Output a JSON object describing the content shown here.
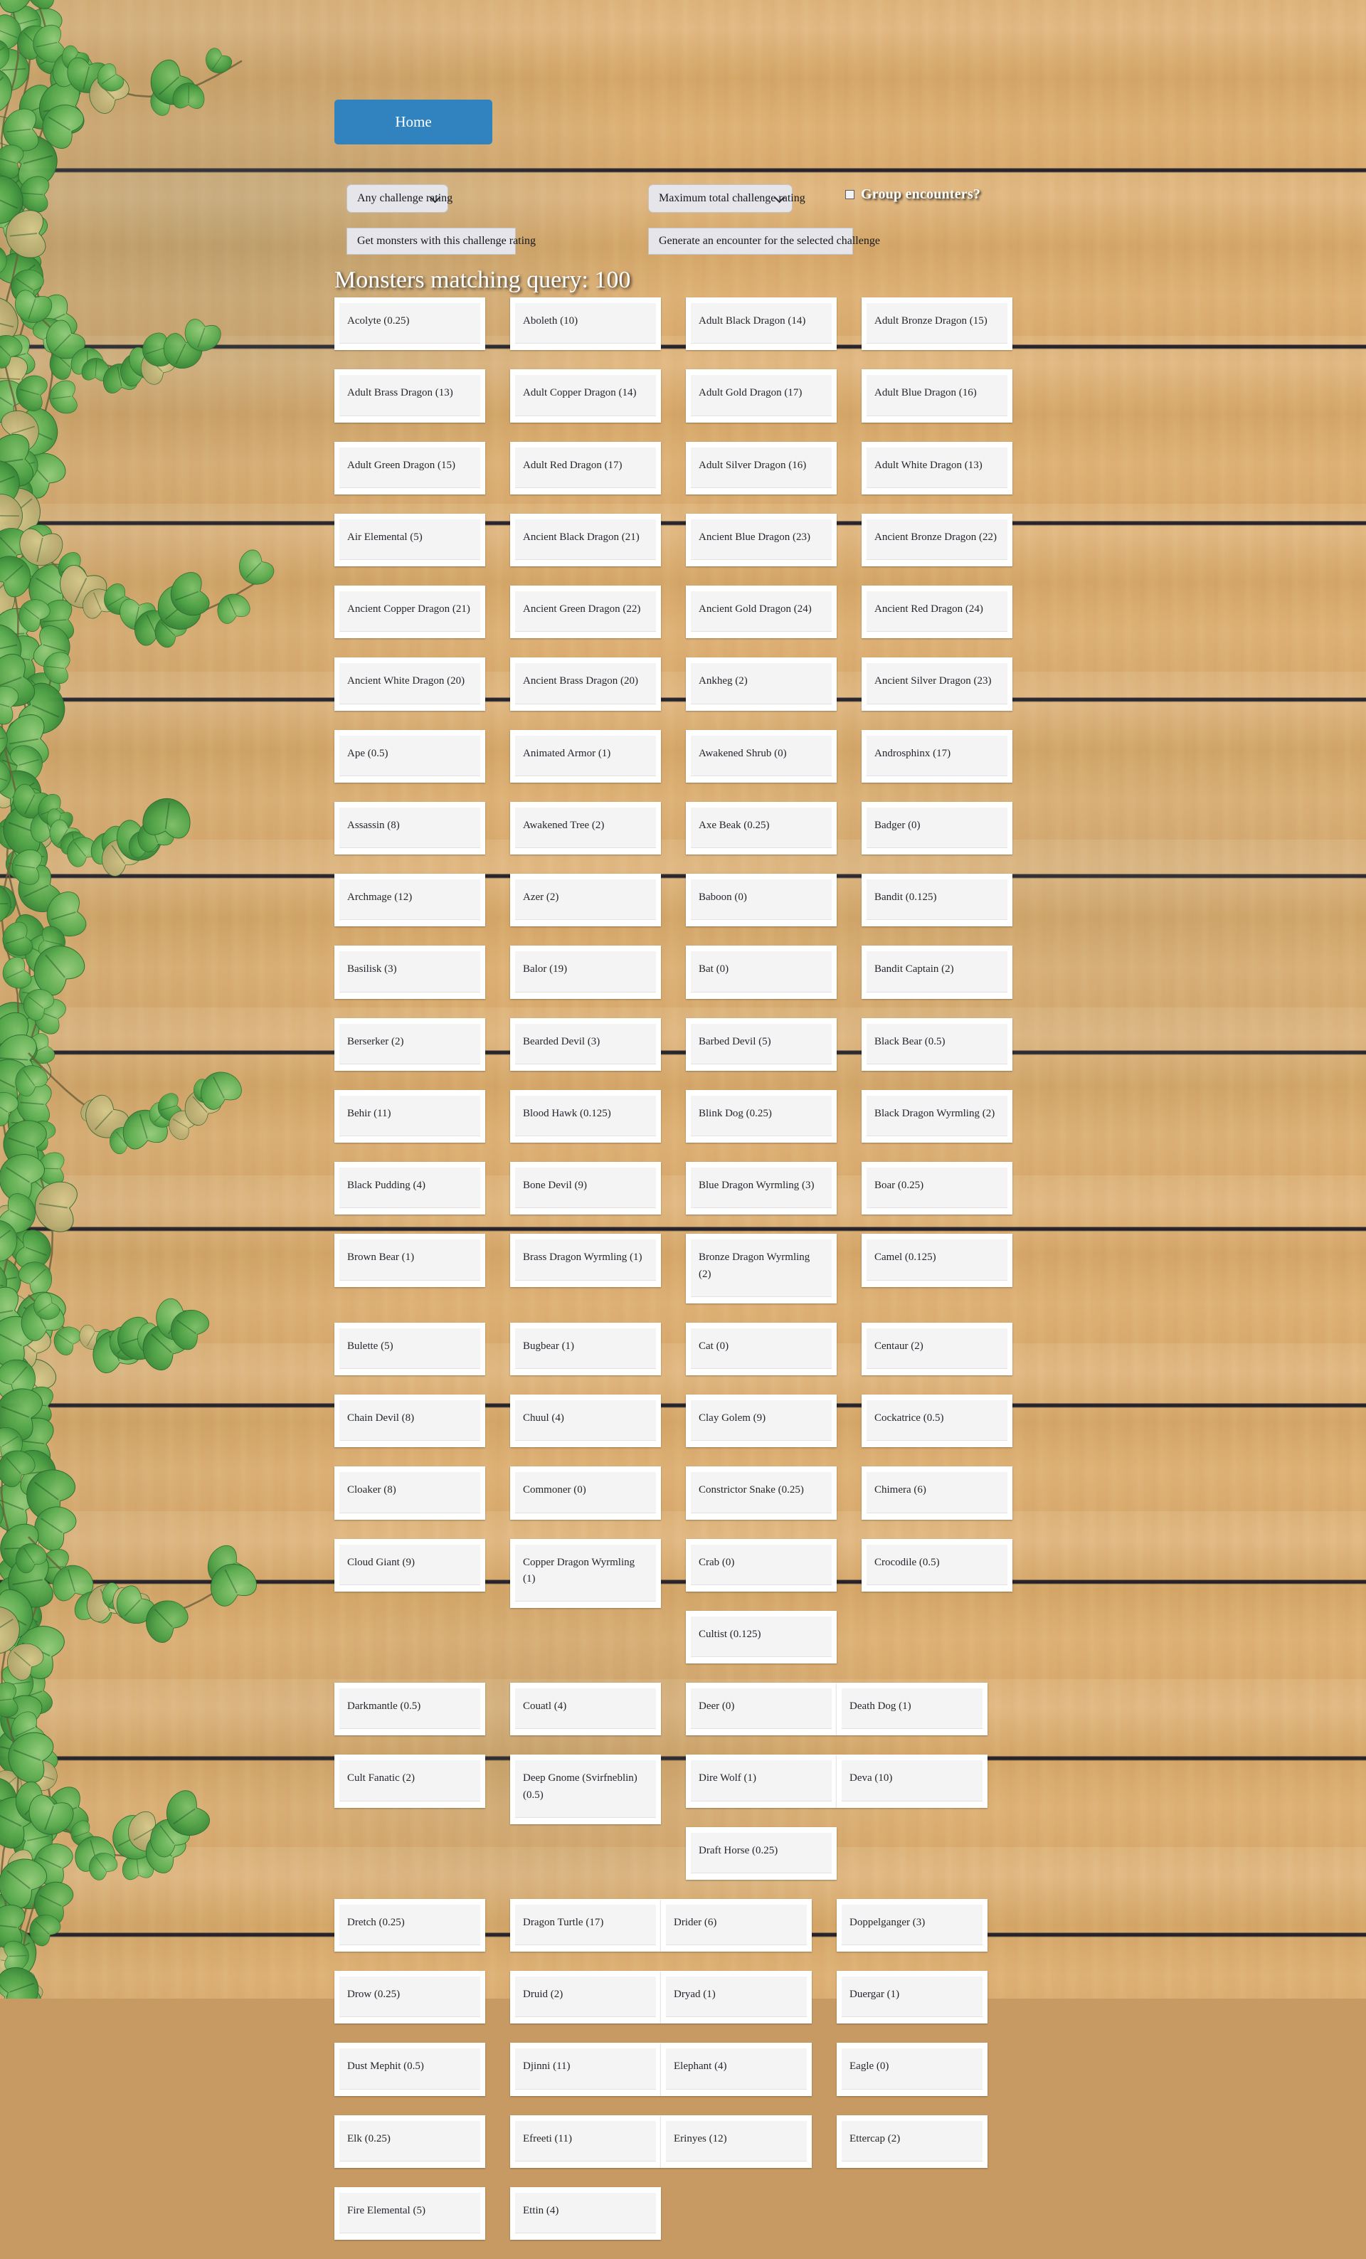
{
  "navbar": {
    "home_label": "Home"
  },
  "controls": {
    "challenge_rating_select": {
      "value": "Any challenge rating",
      "icon": "chevron-down-icon"
    },
    "total_challenge_select": {
      "value": "Maximum total challenge rating",
      "icon": "chevron-down-icon"
    },
    "get_monsters_button": "Get monsters with this challenge rating",
    "generate_encounter_button": "Generate an encounter for the selected challenge",
    "group_encounters_label": "Group encounters?",
    "group_encounters_checked": false
  },
  "page_title": "Monsters matching query: 100",
  "theme": {
    "nav_button_color": "#3183bf",
    "card_background": "#ffffff",
    "card_inner_background": "#f4f4f5",
    "control_background": "#e6e6ea",
    "title_color": "#ffffff"
  },
  "monsters": [
    "Acolyte (0.25)",
    "Aboleth (10)",
    "Adult Black Dragon (14)",
    "Adult Bronze Dragon (15)",
    "Adult Brass Dragon (13)",
    "Adult Copper Dragon (14)",
    "Adult Gold Dragon (17)",
    "Adult Blue Dragon (16)",
    "Adult Green Dragon (15)",
    "Adult Red Dragon (17)",
    "Adult Silver Dragon (16)",
    "Adult White Dragon (13)",
    "Air Elemental (5)",
    "Ancient Black Dragon (21)",
    "Ancient Blue Dragon (23)",
    "Ancient Bronze Dragon (22)",
    "Ancient Copper Dragon (21)",
    "Ancient Green Dragon (22)",
    "Ancient Gold Dragon (24)",
    "Ancient Red Dragon (24)",
    "Ancient White Dragon (20)",
    "Ancient Brass Dragon (20)",
    "Ankheg (2)",
    "Ancient Silver Dragon (23)",
    "Ape (0.5)",
    "Animated Armor (1)",
    "Awakened Shrub (0)",
    "Androsphinx (17)",
    "Assassin (8)",
    "Awakened Tree (2)",
    "Axe Beak (0.25)",
    "Badger (0)",
    "Archmage (12)",
    "Azer (2)",
    "Baboon (0)",
    "Bandit (0.125)",
    "Basilisk (3)",
    "Balor (19)",
    "Bat (0)",
    "Bandit Captain (2)",
    "Berserker (2)",
    "Bearded Devil (3)",
    "Barbed Devil (5)",
    "Black Bear (0.5)",
    "Behir (11)",
    "Blood Hawk (0.125)",
    "Blink Dog (0.25)",
    "Black Dragon Wyrmling (2)",
    "Black Pudding (4)",
    "Bone Devil (9)",
    "Blue Dragon Wyrmling (3)",
    "Boar (0.25)",
    "Brown Bear (1)",
    "Brass Dragon Wyrmling (1)",
    "Bronze Dragon Wyrmling (2)",
    "Camel (0.125)",
    "Bulette (5)",
    "Bugbear (1)",
    "Cat (0)",
    "Centaur (2)",
    "Chain Devil (8)",
    "Chuul (4)",
    "Clay Golem (9)",
    "Cockatrice (0.5)",
    "Cloaker (8)",
    "Commoner (0)",
    "Constrictor Snake (0.25)",
    "Chimera (6)",
    "Cloud Giant (9)",
    "Copper Dragon Wyrmling (1)",
    "Crab (0)",
    "Crocodile (0.5)",
    "Cultist (0.125)",
    "Darkmantle (0.5)",
    "Couatl (4)",
    "Deer (0)",
    "Death Dog (1)",
    "Cult Fanatic (2)",
    "Deep Gnome (Svirfneblin) (0.5)",
    "Dire Wolf (1)",
    "Deva (10)",
    "Draft Horse (0.25)",
    "Dretch (0.25)",
    "Dragon Turtle (17)",
    "Drider (6)",
    "Doppelganger (3)",
    "Drow (0.25)",
    "Druid (2)",
    "Dryad (1)",
    "Duergar (1)",
    "Dust Mephit (0.5)",
    "Djinni (11)",
    "Elephant (4)",
    "Eagle (0)",
    "Elk (0.25)",
    "Efreeti (11)",
    "Erinyes (12)",
    "Ettercap (2)",
    "Fire Elemental (5)",
    "Ettin (4)"
  ]
}
